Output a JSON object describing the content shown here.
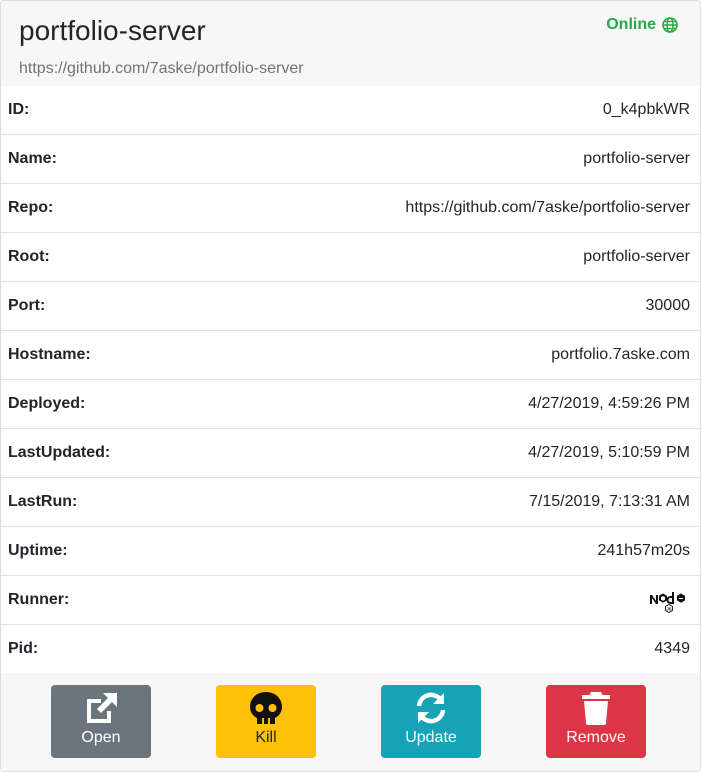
{
  "header": {
    "title": "portfolio-server",
    "subtitle": "https://github.com/7aske/portfolio-server",
    "status": "Online",
    "status_icon": "globe-icon",
    "status_color": "#28a745"
  },
  "rows": [
    {
      "label": "ID:",
      "value": "0_k4pbkWR"
    },
    {
      "label": "Name:",
      "value": "portfolio-server"
    },
    {
      "label": "Repo:",
      "value": "https://github.com/7aske/portfolio-server"
    },
    {
      "label": "Root:",
      "value": "portfolio-server"
    },
    {
      "label": "Port:",
      "value": "30000"
    },
    {
      "label": "Hostname:",
      "value": "portfolio.7aske.com"
    },
    {
      "label": "Deployed:",
      "value": "4/27/2019, 4:59:26 PM"
    },
    {
      "label": "LastUpdated:",
      "value": "4/27/2019, 5:10:59 PM"
    },
    {
      "label": "LastRun:",
      "value": "7/15/2019, 7:13:31 AM"
    },
    {
      "label": "Uptime:",
      "value": "241h57m20s"
    },
    {
      "label": "Runner:",
      "value_icon": "nodejs-logo-icon"
    },
    {
      "label": "Pid:",
      "value": "4349"
    }
  ],
  "buttons": {
    "open": {
      "label": "Open",
      "icon": "external-link-icon",
      "color": "#6c757d"
    },
    "kill": {
      "label": "Kill",
      "icon": "skull-icon",
      "color": "#ffc107"
    },
    "update": {
      "label": "Update",
      "icon": "sync-icon",
      "color": "#17a2b8"
    },
    "remove": {
      "label": "Remove",
      "icon": "trash-icon",
      "color": "#dc3545"
    }
  }
}
